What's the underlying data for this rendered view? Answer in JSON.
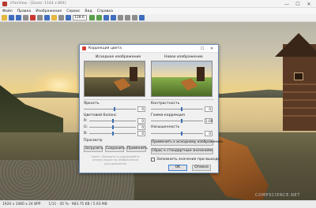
{
  "window": {
    "title": "IrfanView - [Zoom: 1144 x 864]",
    "minimize": "—",
    "maximize": "☐",
    "close": "✕"
  },
  "menu": [
    "Файл",
    "Правка",
    "Изображение",
    "Сервис",
    "Вид",
    "Справка"
  ],
  "toolbar": {
    "zoom_value": "128.6"
  },
  "photo": {
    "watermark": "COMPSCIENCE.NET"
  },
  "status": {
    "size": "1920 x 1080 x 24 BPP",
    "info": "1/11 · 45 % · 983.75 KB / 5.93 MB"
  },
  "dialog": {
    "title": "Коррекция цвета",
    "close": "✕",
    "maximize": "☐",
    "original_label": "Исходное изображение",
    "new_label": "Новое изображение",
    "brightness_label": "Яркость",
    "brightness_value": "0",
    "contrast_label": "Контрастность",
    "contrast_value": "0",
    "color_balance_label": "Цветовой баланс",
    "r_label": "R:",
    "r_value": "0",
    "g_label": "G:",
    "g_value": "0",
    "b_label": "B:",
    "b_value": "0",
    "gamma_label": "Гамма-коррекция",
    "gamma_value": "1.00",
    "saturation_label": "Насыщенность",
    "saturation_value": "0",
    "preview_label": "Просмотр",
    "apply_original_button": "Применить к исходному изображению",
    "reset_button": "Сброс к стандартным значениям",
    "load_button": "Загрузить",
    "save_button": "Сохранить",
    "apply_button": "Применить",
    "note_text": "Совет: Нажмите и удерживайте кнопку мыши на изображении для сравнения",
    "remember_label": "Запомнить значения при выходе",
    "ok_button": "OK",
    "cancel_button": "Отмена"
  }
}
